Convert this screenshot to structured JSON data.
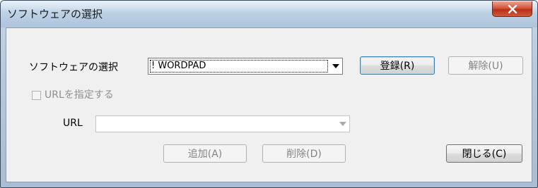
{
  "window": {
    "title": "ソフトウェアの選択"
  },
  "form": {
    "software_label": "ソフトウェアの選択",
    "software_value": "! WORDPAD",
    "register_button": "登録(R)",
    "release_button": "解除(U)",
    "url_checkbox_label": "URLを指定する",
    "url_checkbox_checked": false,
    "url_label": "URL",
    "url_value": "",
    "add_button": "追加(A)",
    "delete_button": "削除(D)",
    "close_button": "閉じる(C)"
  },
  "colors": {
    "close_button": "#c7402a",
    "default_button_border": "#3c7fb1",
    "disabled_text": "#838383"
  }
}
